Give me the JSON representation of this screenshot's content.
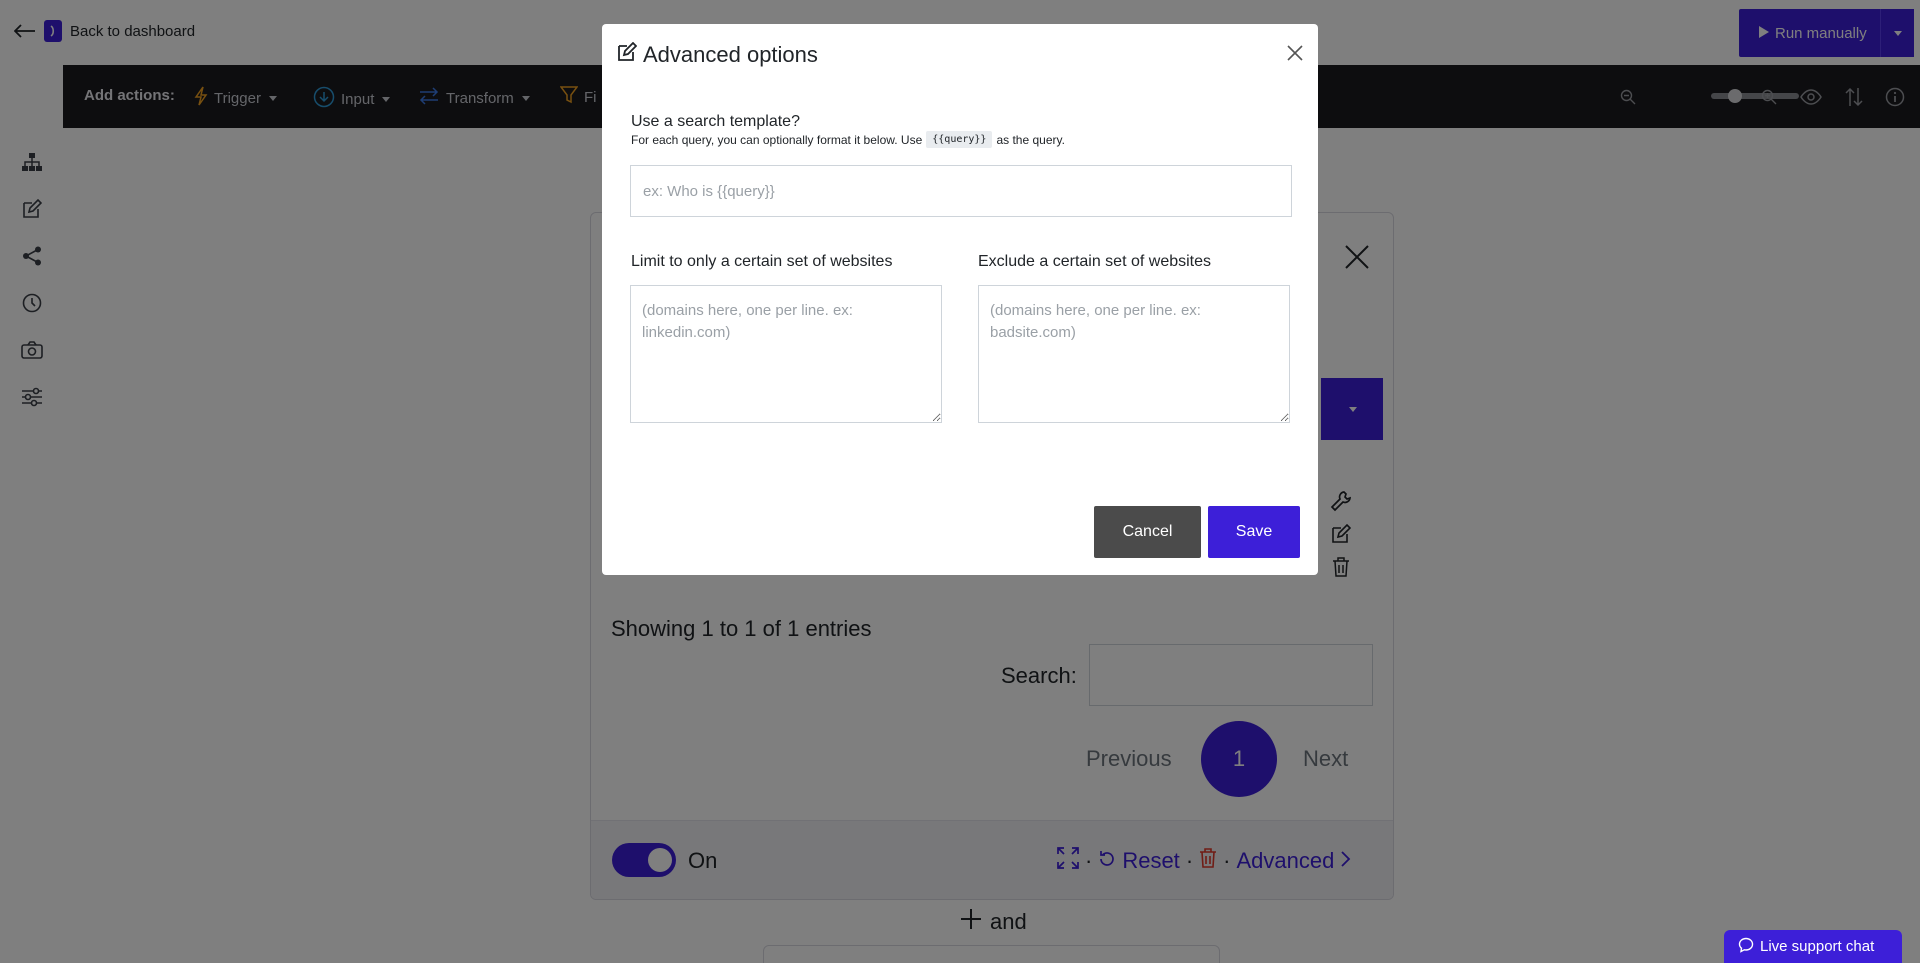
{
  "topbar": {
    "back_label": "Back to dashboard",
    "run_label": "Run manually"
  },
  "actionbar": {
    "label": "Add actions:",
    "items": [
      {
        "label": "Trigger",
        "icon": "lightning-icon",
        "color": "#f0a020"
      },
      {
        "label": "Input",
        "icon": "arrow-down-circle-icon",
        "color": "#2f9bd9"
      },
      {
        "label": "Transform",
        "icon": "swap-arrows-icon",
        "color": "#3d7be8"
      },
      {
        "label": "Fi",
        "icon": "filter-icon",
        "color": "#f0a020"
      }
    ]
  },
  "left_rail": [
    "hierarchy-icon",
    "edit-icon",
    "share-icon",
    "history-icon",
    "camera-icon",
    "sliders-icon"
  ],
  "panel": {
    "entries_text": "Showing 1 to 1 of 1 entries",
    "search_label": "Search:",
    "pager": {
      "prev": "Previous",
      "page": "1",
      "next": "Next"
    },
    "toggle_label": "On",
    "footer": {
      "reset": "Reset",
      "advanced": "Advanced"
    },
    "and_label": "and"
  },
  "support_chat_label": "Live support chat",
  "modal": {
    "title": "Advanced options",
    "template_label": "Use a search template?",
    "help_prefix": "For each query, you can optionally format it below. Use",
    "help_code": "{{query}}",
    "help_suffix": "as the query.",
    "template_placeholder": "ex: Who is {{query}}",
    "include_label": "Limit to only a certain set of websites",
    "include_placeholder": "(domains here, one per line. ex: linkedin.com)",
    "exclude_label": "Exclude a certain set of websites",
    "exclude_placeholder": "(domains here, one per line. ex: badsite.com)",
    "cancel_label": "Cancel",
    "save_label": "Save"
  },
  "colors": {
    "accent": "#3d1fd8",
    "dark_bar": "#1b1b1f",
    "cancel": "#4b4b4b"
  }
}
